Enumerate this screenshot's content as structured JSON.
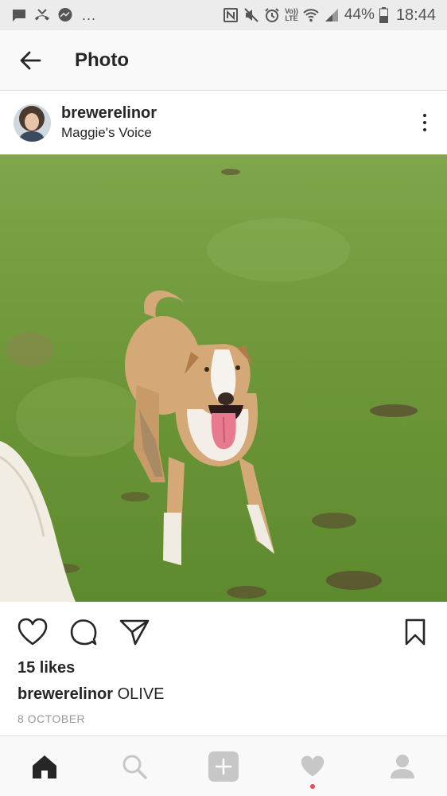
{
  "status_bar": {
    "notification_icons": [
      "message-icon",
      "missed-call-icon",
      "messenger-icon"
    ],
    "overflow": "...",
    "right_icons": [
      "nfc-icon",
      "mute-icon",
      "alarm-icon",
      "volte-icon",
      "wifi-icon",
      "signal-icon"
    ],
    "lte_top": "Vo))",
    "lte_bottom": "LTE",
    "battery": "44%",
    "time": "18:44"
  },
  "header": {
    "title": "Photo"
  },
  "post": {
    "username": "brewerelinor",
    "location": "Maggie's Voice",
    "likes": "15 likes",
    "caption_user": "brewerelinor",
    "caption_text": "OLIVE",
    "date": "8 OCTOBER"
  },
  "colors": {
    "grass": "#6f9a3a",
    "dog_tan": "#d4a877",
    "notification_dot": "#ed4956",
    "secondary_text": "#999999"
  },
  "bottom_nav": {
    "items": [
      "home-icon",
      "search-icon",
      "add-post-icon",
      "activity-heart-icon",
      "profile-icon"
    ],
    "active": "home-icon"
  }
}
